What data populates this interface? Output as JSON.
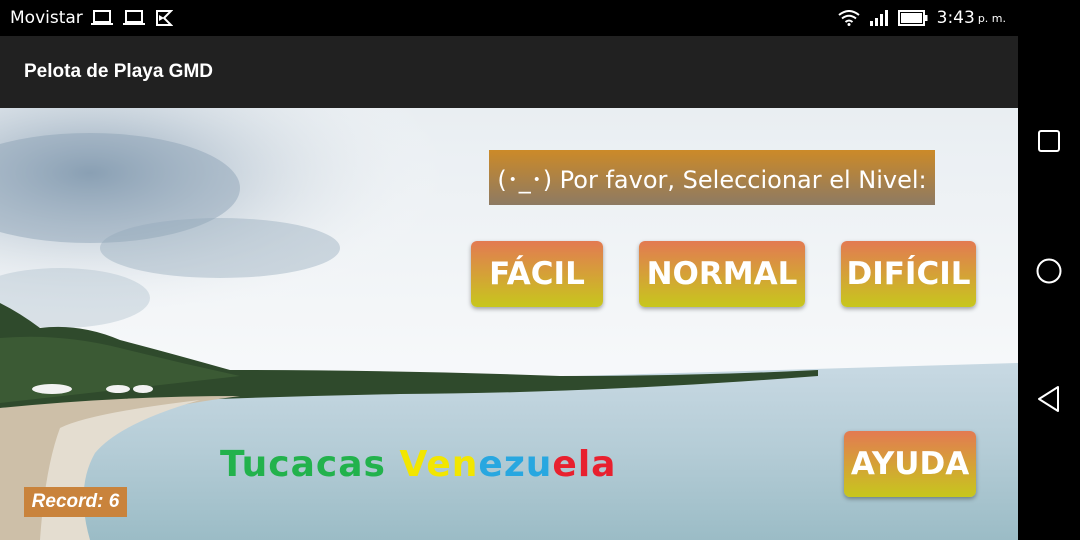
{
  "status_bar": {
    "carrier": "Movistar",
    "time": "3:43",
    "ampm": "p. m.",
    "icons_left": [
      "laptop-icon",
      "laptop-icon",
      "app-notification-icon"
    ],
    "icons_right": [
      "wifi-icon",
      "signal-icon",
      "battery-icon"
    ]
  },
  "app": {
    "title": "Pelota de Playa GMD"
  },
  "level_select": {
    "prompt": "(･_･) Por favor, Seleccionar el Nivel:",
    "easy": "FÁCIL",
    "normal": "NORMAL",
    "hard": "DIFÍCIL"
  },
  "help_label": "AYUDA",
  "location_text": {
    "part1": "Tucacas ",
    "part2": "Ven",
    "part3": "ezu",
    "part4": "ela"
  },
  "record_label": "Record: 6",
  "colors": {
    "button_top": "#e37a52",
    "button_bottom": "#c7c71d",
    "tucacas_green": "#22b24c",
    "venezuela_yellow": "#f2e600",
    "venezuela_blue": "#28a7e0",
    "venezuela_red": "#e8202e"
  },
  "nav": [
    "recents-icon",
    "home-icon",
    "back-icon"
  ]
}
